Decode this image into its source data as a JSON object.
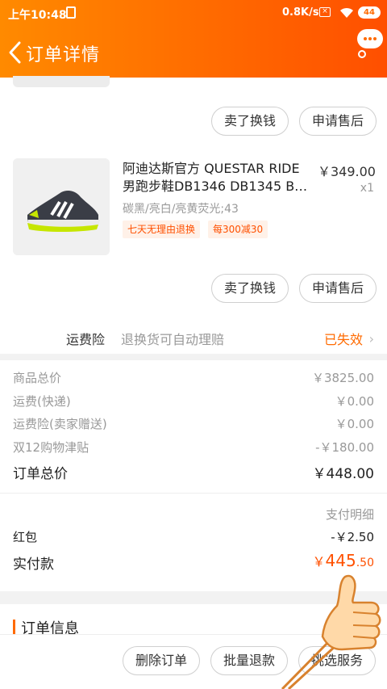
{
  "status_bar": {
    "time": "上午10:48",
    "speed": "0.8K/s",
    "battery": "44"
  },
  "header": {
    "title": "订单详情"
  },
  "prev_item": {
    "btn_sell": "卖了换钱",
    "btn_aftersale": "申请售后"
  },
  "product": {
    "name": "阿迪达斯官方 QUESTAR RIDE 男跑步鞋DB1346 DB1345 B…",
    "price": "￥349.00",
    "qty": "x1",
    "sku": "碳黑/亮白/亮黄荧光;43",
    "tags": [
      "七天无理由退换",
      "每300减30"
    ],
    "btn_sell": "卖了换钱",
    "btn_aftersale": "申请售后"
  },
  "insurance": {
    "label": "运费险",
    "desc": "退换货可自动理赔",
    "status": "已失效"
  },
  "summary": {
    "rows": [
      {
        "label": "商品总价",
        "value": "￥3825.00"
      },
      {
        "label": "运费(快递)",
        "value": "￥0.00"
      },
      {
        "label": "运费险(卖家赠送)",
        "value": "￥0.00"
      },
      {
        "label": "双12购物津贴",
        "value": "-￥180.00"
      }
    ],
    "total_label": "订单总价",
    "total_value": "￥448.00"
  },
  "payment": {
    "detail_link": "支付明细",
    "redpacket_label": "红包",
    "redpacket_value": "-￥2.50",
    "paid_label": "实付款",
    "paid_currency": "￥",
    "paid_int": "445",
    "paid_dec": ".50"
  },
  "order_info": {
    "title": "订单信息"
  },
  "bottom_bar": {
    "delete": "删除订单",
    "batch_refund": "批量退款",
    "pick_service": "挑选服务"
  },
  "colors": {
    "accent": "#ff6a00",
    "price_red": "#ff5000"
  }
}
